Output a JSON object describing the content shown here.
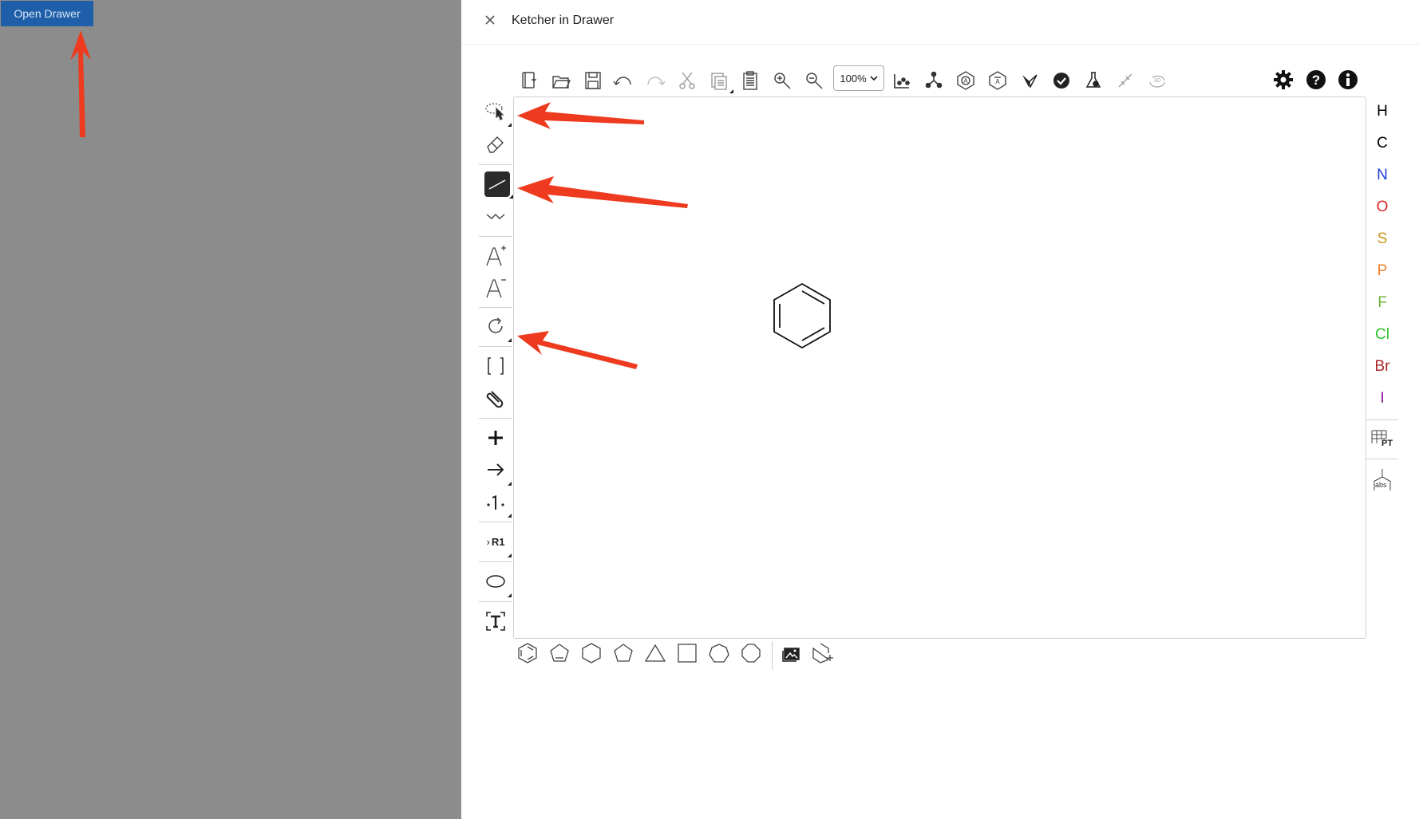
{
  "open_drawer_label": "Open Drawer",
  "drawer": {
    "title": "Ketcher in Drawer"
  },
  "toolbar": {
    "zoom_value": "100%",
    "top_icons": [
      "new-file-icon",
      "open-folder-icon",
      "save-icon",
      "undo-icon",
      "redo-icon",
      "cut-icon",
      "copy-icon",
      "paste-icon",
      "zoom-in-icon",
      "zoom-out-icon",
      "layout-icon",
      "clean-icon",
      "aromatize-icon",
      "dearomatize-icon",
      "calculate-icon",
      "check-icon",
      "analyse-icon",
      "stereo-icon",
      "3d-view-icon",
      "settings-icon",
      "help-icon",
      "info-icon"
    ]
  },
  "left_tools": [
    "lasso-select-icon",
    "eraser-icon",
    "single-bond-icon",
    "chain-icon",
    "charge-plus-icon",
    "charge-minus-icon",
    "rotate-icon",
    "sgroup-bracket-icon",
    "attachment-icon",
    "reaction-plus-icon",
    "reaction-arrow-icon",
    "mapping-icon",
    "rgroup-icon",
    "ellipse-shape-icon",
    "text-tool-icon"
  ],
  "rgroup_label": "R1",
  "atoms": [
    {
      "symbol": "H",
      "color": "#000000"
    },
    {
      "symbol": "C",
      "color": "#000000"
    },
    {
      "symbol": "N",
      "color": "#1f3fd8"
    },
    {
      "symbol": "O",
      "color": "#e0262a"
    },
    {
      "symbol": "S",
      "color": "#c8961a"
    },
    {
      "symbol": "P",
      "color": "#f0802a"
    },
    {
      "symbol": "F",
      "color": "#6fb23a"
    },
    {
      "symbol": "Cl",
      "color": "#2ac22a"
    },
    {
      "symbol": "Br",
      "color": "#a82828"
    },
    {
      "symbol": "I",
      "color": "#8a1a9a"
    }
  ],
  "right_tools": {
    "periodic_table_label": "PT",
    "abs_label": "abs"
  },
  "bottom_templates": [
    "benzene-template-icon",
    "cyclopentadiene-template-icon",
    "cyclohexane-template-icon",
    "cyclopentane-template-icon",
    "cyclopropane-template-icon",
    "cyclobutane-template-icon",
    "cycloheptane-template-icon",
    "cyclooctane-template-icon",
    "template-library-icon",
    "custom-template-icon"
  ],
  "colors": {
    "annotation_arrow": "#ee3a1e",
    "open_button_bg": "#1f5ea8",
    "overlay_bg": "#8c8c8c"
  }
}
